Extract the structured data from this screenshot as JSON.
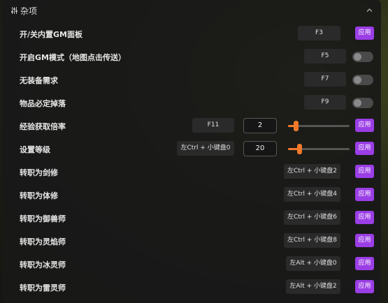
{
  "section": {
    "title": "杂项",
    "icon": "sliders-icon",
    "collapse_icon": "chevron-up-icon"
  },
  "colors": {
    "accent": "#9b3ee6",
    "slider": "#f07a2a"
  },
  "rows": [
    {
      "label": "开/关内置GM面板",
      "hotkey": "F3",
      "action": "应用"
    },
    {
      "label": "开启GM模式（地图点击传送）",
      "hotkey": "F5"
    },
    {
      "label": "无装备需求",
      "hotkey": "F7"
    },
    {
      "label": "物品必定掉落",
      "hotkey": "F9"
    },
    {
      "label": "经验获取倍率",
      "hotkey": "F11",
      "value": "2",
      "action": "应用",
      "slider_fraction": 0.12
    },
    {
      "label": "设置等级",
      "hotkey": "左Ctrl + 小键盘0",
      "value": "20",
      "action": "应用",
      "slider_fraction": 0.18
    },
    {
      "label": "转职为剑修",
      "hotkey": "左Ctrl + 小键盘2",
      "action": "应用"
    },
    {
      "label": "转职为体修",
      "hotkey": "左Ctrl + 小键盘4",
      "action": "应用"
    },
    {
      "label": "转职为御兽师",
      "hotkey": "左Ctrl + 小键盘6",
      "action": "应用"
    },
    {
      "label": "转职为灵焰师",
      "hotkey": "左Ctrl + 小键盘8",
      "action": "应用"
    },
    {
      "label": "转职为冰灵师",
      "hotkey": "左Alt + 小键盘0",
      "action": "应用"
    },
    {
      "label": "转职为雷灵师",
      "hotkey": "左Alt + 小键盘2",
      "action": "应用"
    }
  ]
}
